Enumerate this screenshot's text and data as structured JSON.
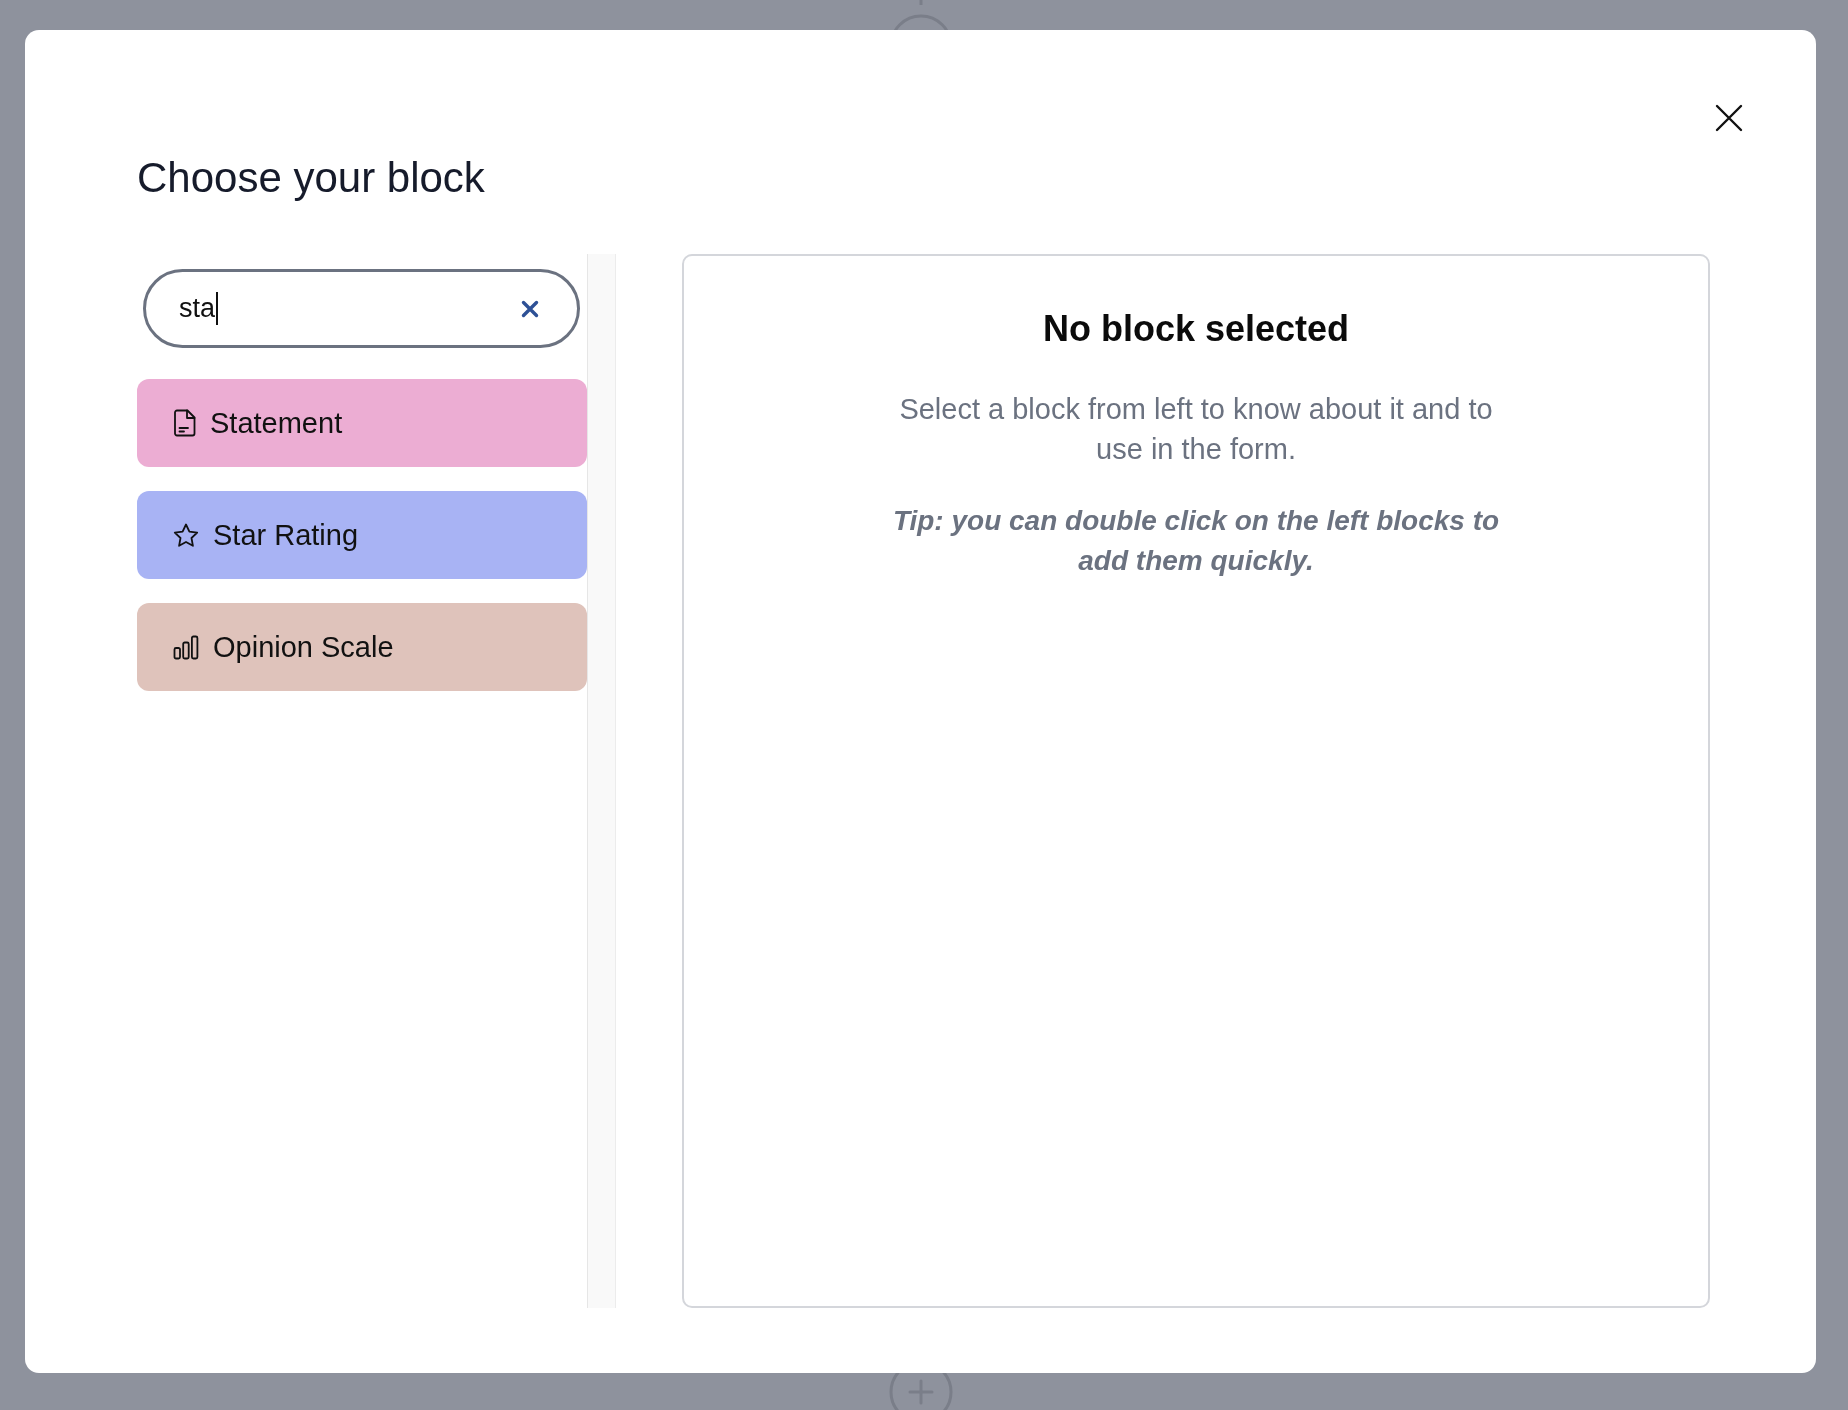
{
  "dialog": {
    "title": "Choose your block",
    "search": {
      "value": "sta",
      "focused": true
    },
    "blocks": [
      {
        "label": "Statement",
        "kind": "statement",
        "color": "#ecadd3",
        "selected": false
      },
      {
        "label": "Star Rating",
        "kind": "rating",
        "color": "#a8b3f4",
        "selected": false
      },
      {
        "label": "Opinion Scale",
        "kind": "scale",
        "color": "#dfc3bb",
        "selected": false
      }
    ],
    "preview": {
      "title": "No block selected",
      "text": "Select a block from left to know about it and to use in the form.",
      "tip": "Tip: you can double click on the left blocks to add them quickly."
    }
  }
}
